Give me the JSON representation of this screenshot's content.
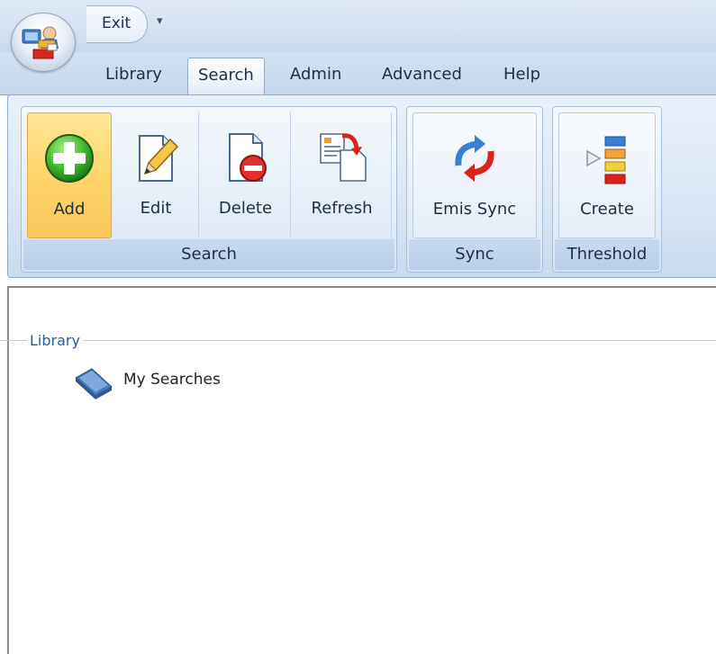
{
  "quick_access": {
    "exit_label": "Exit",
    "dropdown_glyph": "▾"
  },
  "tabs": [
    {
      "label": "Library",
      "active": false
    },
    {
      "label": "Search",
      "active": true
    },
    {
      "label": "Admin",
      "active": false
    },
    {
      "label": "Advanced",
      "active": false
    },
    {
      "label": "Help",
      "active": false
    }
  ],
  "ribbon": {
    "groups": [
      {
        "label": "Search",
        "buttons": [
          {
            "label": "Add",
            "icon": "add-icon",
            "highlighted": true
          },
          {
            "label": "Edit",
            "icon": "edit-icon",
            "highlighted": false
          },
          {
            "label": "Delete",
            "icon": "delete-icon",
            "highlighted": false
          },
          {
            "label": "Refresh",
            "icon": "refresh-icon",
            "highlighted": false
          }
        ]
      },
      {
        "label": "Sync",
        "buttons": [
          {
            "label": "Emis Sync",
            "icon": "sync-icon",
            "highlighted": false
          }
        ]
      },
      {
        "label": "Threshold",
        "buttons": [
          {
            "label": "Create",
            "icon": "threshold-create-icon",
            "highlighted": false
          }
        ]
      }
    ]
  },
  "library": {
    "section_label": "Library",
    "items": [
      {
        "label": "My Searches",
        "icon": "folder-icon"
      }
    ]
  },
  "colors": {
    "accent_text": "#2b5ca8",
    "highlight": "#ffd56b",
    "ribbon": "#dbe7f5"
  }
}
